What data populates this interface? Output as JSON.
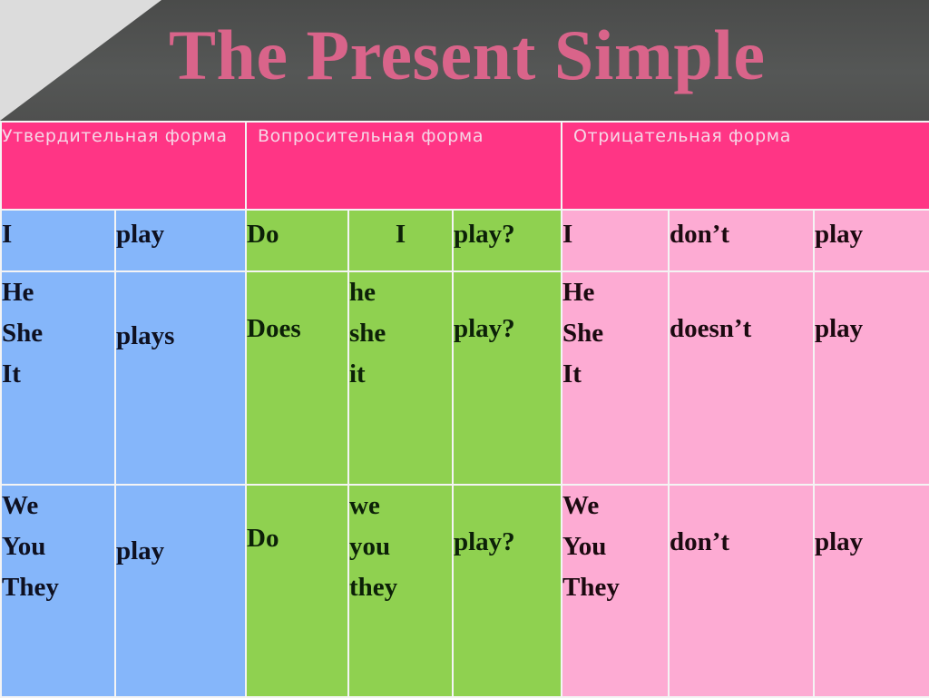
{
  "title": "The Present Simple",
  "headers": {
    "affirmative": "Утвердительная форма",
    "interrogative": "Вопросительная форма",
    "negative": "Отрицательная форма"
  },
  "colors": {
    "title_band": "#4f504f",
    "title_text": "#d9648a",
    "header_bg": "#ff3585",
    "affirmative_bg": "#85b6fa",
    "interrogative_bg": "#8fd150",
    "negative_bg": "#fdabd3"
  },
  "rows": [
    {
      "affirmative": {
        "subject": [
          "I"
        ],
        "verb": "play"
      },
      "interrogative": {
        "aux": "Do",
        "subject": [
          "I"
        ],
        "verb": "play?"
      },
      "negative": {
        "subject": [
          "I"
        ],
        "aux": "don’t",
        "verb": "play"
      }
    },
    {
      "affirmative": {
        "subject": [
          "He",
          "She",
          "It"
        ],
        "verb": "plays"
      },
      "interrogative": {
        "aux": "Does",
        "subject": [
          "he",
          "she",
          "it"
        ],
        "verb": "play?"
      },
      "negative": {
        "subject": [
          "He",
          "She",
          "It"
        ],
        "aux": "doesn’t",
        "verb": "play"
      }
    },
    {
      "affirmative": {
        "subject": [
          "We",
          "You",
          "They"
        ],
        "verb": "play"
      },
      "interrogative": {
        "aux": "Do",
        "subject": [
          "we",
          "you",
          "they"
        ],
        "verb": "play?"
      },
      "negative": {
        "subject": [
          "We",
          "You",
          "They"
        ],
        "aux": "don’t",
        "verb": "play"
      }
    }
  ]
}
